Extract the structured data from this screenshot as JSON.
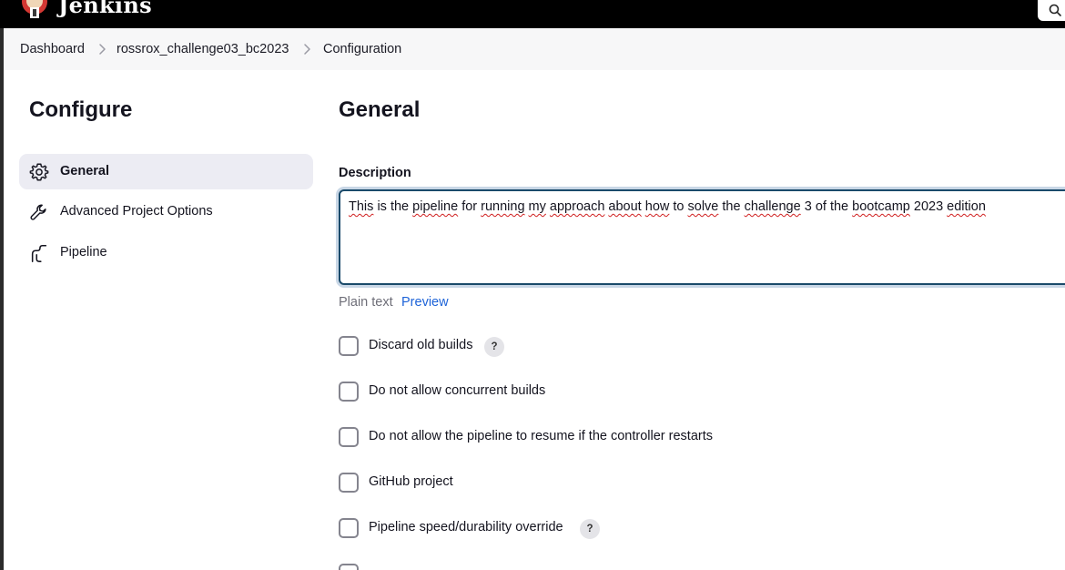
{
  "header": {
    "brand": "Jenkins",
    "search_icon": "search-icon",
    "logo_icon": "jenkins-logo"
  },
  "breadcrumb": {
    "items": [
      "Dashboard",
      "rossrox_challenge03_bc2023",
      "Configuration"
    ],
    "separator_icon": "chevron-right-icon"
  },
  "sidebar": {
    "title": "Configure",
    "items": [
      {
        "label": "General",
        "icon": "gear-icon",
        "active": true
      },
      {
        "label": "Advanced Project Options",
        "icon": "wrench-icon",
        "active": false
      },
      {
        "label": "Pipeline",
        "icon": "pipeline-icon",
        "active": false
      }
    ]
  },
  "main": {
    "section_title": "General",
    "description": {
      "label": "Description",
      "value_words": [
        "This",
        "is",
        "the",
        "pipeline",
        "for",
        "running",
        "my",
        "approach",
        "about",
        "how",
        "to",
        "solve",
        "the",
        "challenge",
        "3",
        "of",
        "the",
        "bootcamp",
        "2023",
        "edition"
      ],
      "format_label": "Plain text",
      "preview_label": "Preview"
    },
    "options": [
      {
        "label": "Discard old builds",
        "checked": false,
        "help": "?"
      },
      {
        "label": "Do not allow concurrent builds",
        "checked": false
      },
      {
        "label": "Do not allow the pipeline to resume if the controller restarts",
        "checked": false
      },
      {
        "label": "GitHub project",
        "checked": false
      },
      {
        "label": "Pipeline speed/durability override",
        "checked": false,
        "help": "?"
      }
    ]
  },
  "colors": {
    "header_bg": "#000000",
    "active_item_bg": "#ececf3",
    "link": "#1d63d8",
    "focus_border": "#1a4a6a",
    "spellcheck": "#d02020"
  }
}
